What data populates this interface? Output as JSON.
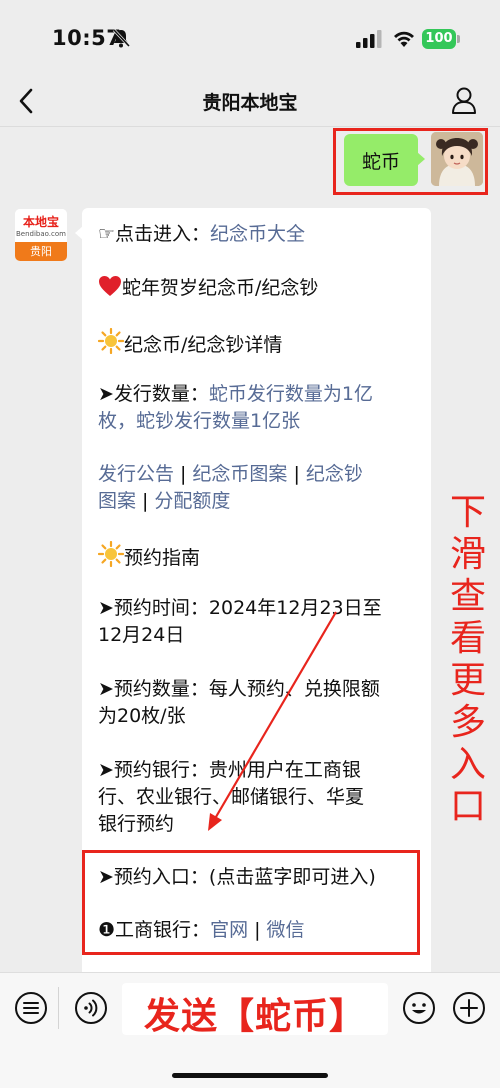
{
  "status": {
    "time": "10:57",
    "battery": "100"
  },
  "nav": {
    "title": "贵阳本地宝"
  },
  "outgoing": {
    "text": "蛇币"
  },
  "account_logo": {
    "name": "本地宝",
    "sub": "Bendibao.com",
    "city": "贵阳"
  },
  "message": {
    "entry_prefix": "☞点击进入：",
    "entry_link": "纪念币大全",
    "item1_emoji": "❤️",
    "item1": "蛇年贺岁纪念币/纪念钞",
    "item2_emoji": "☀️",
    "item2": "纪念币/纪念钞详情",
    "issue_prefix": "➤发行数量：",
    "issue_line1": "蛇币发行数量为1亿",
    "issue_line2": "枚，蛇钞发行数量1亿张",
    "links_row1": [
      "发行公告",
      "纪念币图案",
      "纪念钞"
    ],
    "links_row2": [
      "图案",
      "分配额度"
    ],
    "guide_emoji": "☀️",
    "guide": "预约指南",
    "time_line1": "➤预约时间：2024年12月23日至",
    "time_line2": "12月24日",
    "qty_line1": "➤预约数量：每人预约、兑换限额",
    "qty_line2": "为20枚/张",
    "bank_line1": "➤预约银行：贵州用户在工商银",
    "bank_line2": "行、农业银行、邮储银行、华夏",
    "bank_line3": "银行预约",
    "entry2": "➤预约入口：(点击蓝字即可进入)",
    "icbc_num": "❶",
    "icbc_label": "工商银行：",
    "icbc_link1": "官网",
    "icbc_link2": "微信"
  },
  "annotation": {
    "vertical_text": [
      "下",
      "滑",
      "查",
      "看",
      "更",
      "多",
      "入",
      "口"
    ],
    "send_hint": "发送【蛇币】"
  },
  "colors": {
    "accent_red": "#e8251d",
    "link_blue": "#576b95",
    "bubble_green": "#95ec69"
  }
}
